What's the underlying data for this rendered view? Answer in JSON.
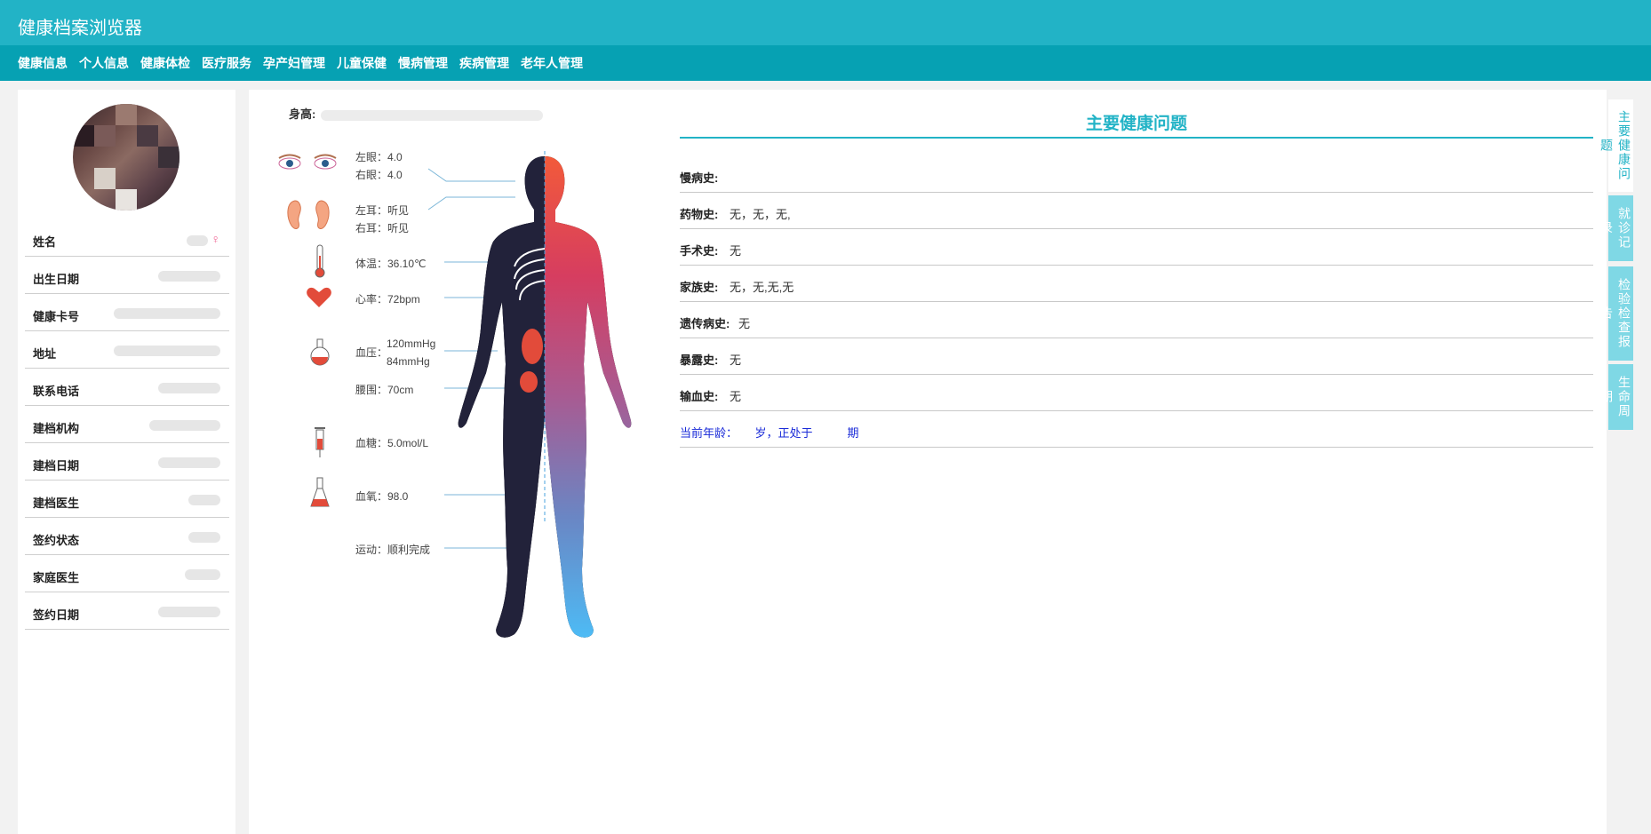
{
  "app": {
    "title": "健康档案浏览器"
  },
  "nav": {
    "items": [
      "健康信息",
      "个人信息",
      "健康体检",
      "医疗服务",
      "孕产妇管理",
      "儿童保健",
      "慢病管理",
      "疾病管理",
      "老年人管理"
    ]
  },
  "profile": {
    "rows": [
      {
        "label": "姓名",
        "value": ""
      },
      {
        "label": "出生日期",
        "value": ""
      },
      {
        "label": "健康卡号",
        "value": ""
      },
      {
        "label": "地址",
        "value": ""
      },
      {
        "label": "联系电话",
        "value": ""
      },
      {
        "label": "建档机构",
        "value": ""
      },
      {
        "label": "建档日期",
        "value": ""
      },
      {
        "label": "建档医生",
        "value": ""
      },
      {
        "label": "签约状态",
        "value": ""
      },
      {
        "label": "家庭医生",
        "value": ""
      },
      {
        "label": "签约日期",
        "value": ""
      }
    ],
    "gender_icon": "female-icon"
  },
  "body_metrics": {
    "height_label": "身高:",
    "left_eye": "左眼：4.0",
    "right_eye": "右眼：4.0",
    "left_ear": "左耳：听见",
    "right_ear": "右耳：听见",
    "temperature": "体温：36.10℃",
    "heart_rate": "心率：72bpm",
    "bp_systolic": "120mmHg",
    "bp_diastolic": "84mmHg",
    "bp_label": "血压：",
    "waist": "腰围：70cm",
    "blood_sugar": "血糖：5.0mol/L",
    "blood_oxygen": "血氧：98.0",
    "exercise": "运动：顺利完成"
  },
  "health_problems": {
    "title": "主要健康问题",
    "rows": [
      {
        "label": "慢病史:",
        "value": ""
      },
      {
        "label": "药物史:",
        "value": "无，无，无,"
      },
      {
        "label": "手术史:",
        "value": "无"
      },
      {
        "label": "家族史:",
        "value": "无，无,无,无"
      },
      {
        "label": "遗传病史:",
        "value": "无"
      },
      {
        "label": "暴露史:",
        "value": "无"
      },
      {
        "label": "输血史:",
        "value": "无"
      }
    ],
    "age_line": "当前年龄：　　岁，正处于　　　期"
  },
  "side_tabs": [
    "主要健康问题",
    "就诊记录",
    "检验检查报告",
    "生命周期"
  ],
  "colors": {
    "primary": "#22b3c6",
    "nav": "#06a1b3",
    "tab": "#7fd8e5"
  }
}
